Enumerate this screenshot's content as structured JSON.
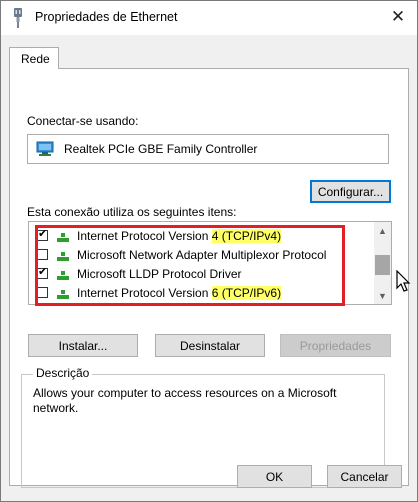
{
  "window": {
    "title": "Propriedades de Ethernet",
    "close_glyph": "✕"
  },
  "tabs": [
    {
      "label": "Rede"
    }
  ],
  "connect_using": {
    "label": "Conectar-se usando:",
    "adapter_name": "Realtek PCIe GBE Family Controller"
  },
  "buttons": {
    "configure": "Configurar...",
    "install": "Instalar...",
    "uninstall": "Desinstalar",
    "properties": "Propriedades",
    "ok": "OK",
    "cancel": "Cancelar"
  },
  "items_list": {
    "label": "Esta conexão utiliza os seguintes itens:",
    "items": [
      {
        "pre": "Internet Protocol Version ",
        "highlight": "4 (TCP/IPv4)",
        "checked": true
      },
      {
        "pre": "Microsoft Network Adapter Multiplexor Protocol",
        "highlight": "",
        "checked": false
      },
      {
        "pre": "Microsoft LLDP Protocol Driver",
        "highlight": "",
        "checked": true
      },
      {
        "pre": "Internet Protocol Version ",
        "highlight": "6 (TCP/IPv6)",
        "checked": false
      }
    ]
  },
  "description": {
    "legend": "Descrição",
    "text": "Allows your computer to access resources on a Microsoft network."
  },
  "colors": {
    "highlight": "#ffff66",
    "annotation_red": "#e31e24",
    "focus_blue": "#0078d7",
    "protocol_green": "#2e9e2e"
  }
}
